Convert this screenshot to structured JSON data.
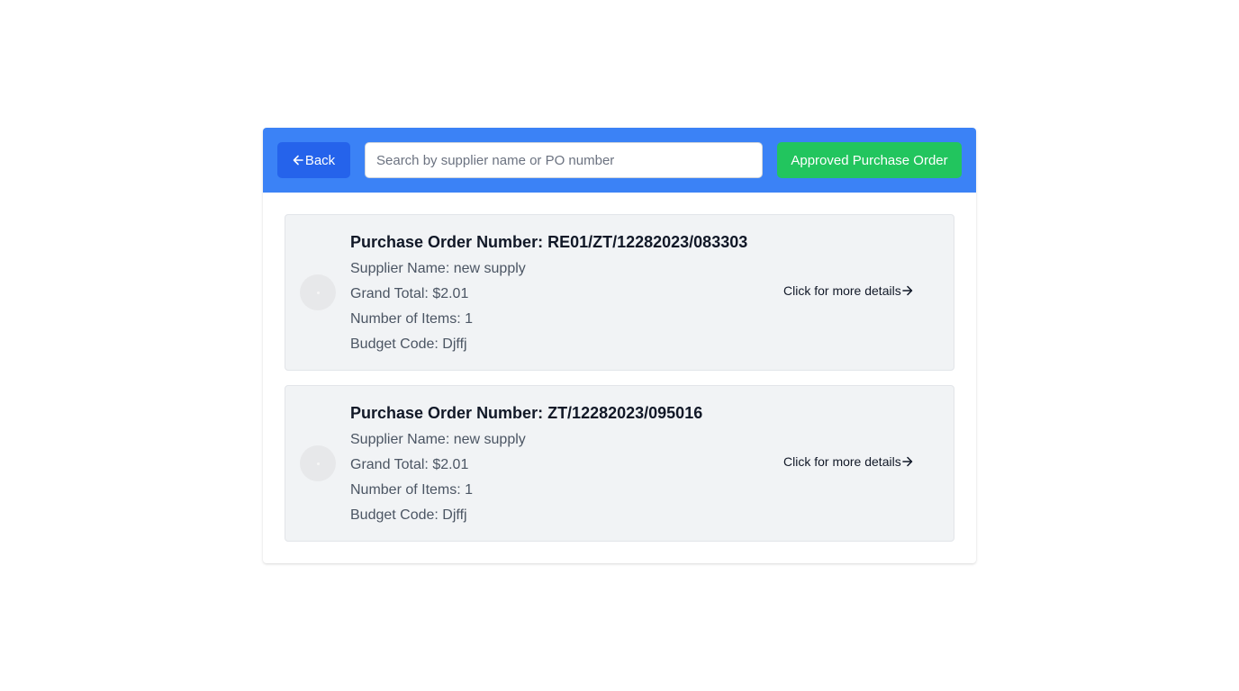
{
  "toolbar": {
    "back_label": "Back",
    "search_placeholder": "Search by supplier name or PO number",
    "search_value": "",
    "approved_label": "Approved Purchase Order"
  },
  "orders": [
    {
      "po_number": "Purchase Order Number: RE01/ZT/12282023/083303",
      "supplier": "Supplier Name: new supply",
      "grand_total": "Grand Total: $2.01",
      "items": "Number of Items: 1",
      "budget_code": "Budget Code: Djffj",
      "link_label": "Click for more details"
    },
    {
      "po_number": "Purchase Order Number: ZT/12282023/095016",
      "supplier": "Supplier Name: new supply",
      "grand_total": "Grand Total: $2.01",
      "items": "Number of Items: 1",
      "budget_code": "Budget Code: Djffj",
      "link_label": "Click for more details"
    }
  ],
  "icons": {
    "back": "arrow-left-icon",
    "details": "arrow-right-icon"
  },
  "colors": {
    "toolbar_bg": "#3b82f6",
    "back_button": "#2563eb",
    "approved_button": "#22c55e",
    "card_bg": "#f1f3f5"
  }
}
